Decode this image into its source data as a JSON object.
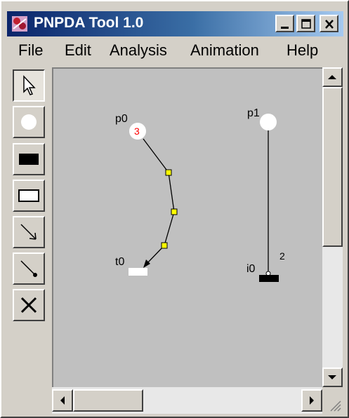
{
  "window": {
    "title": "PNPDA Tool 1.0"
  },
  "menu": [
    "File",
    "Edit",
    "Analysis",
    "Animation",
    "Help"
  ],
  "tools": [
    "select-arrow-tool",
    "place-tool",
    "timed-transition-tool",
    "immediate-transition-tool",
    "arc-tool",
    "inhibitor-arc-tool",
    "delete-tool"
  ],
  "net": {
    "places": [
      {
        "label": "p0",
        "tokens": "3"
      },
      {
        "label": "p1",
        "tokens": ""
      }
    ],
    "transitions": [
      {
        "label": "t0"
      },
      {
        "label": "i0"
      }
    ],
    "arc_weight": "2"
  },
  "colors": {
    "token": "#ff0000",
    "arc_point": "#ffff00",
    "title_start": "#0a246a",
    "title_end": "#a6caf0"
  }
}
